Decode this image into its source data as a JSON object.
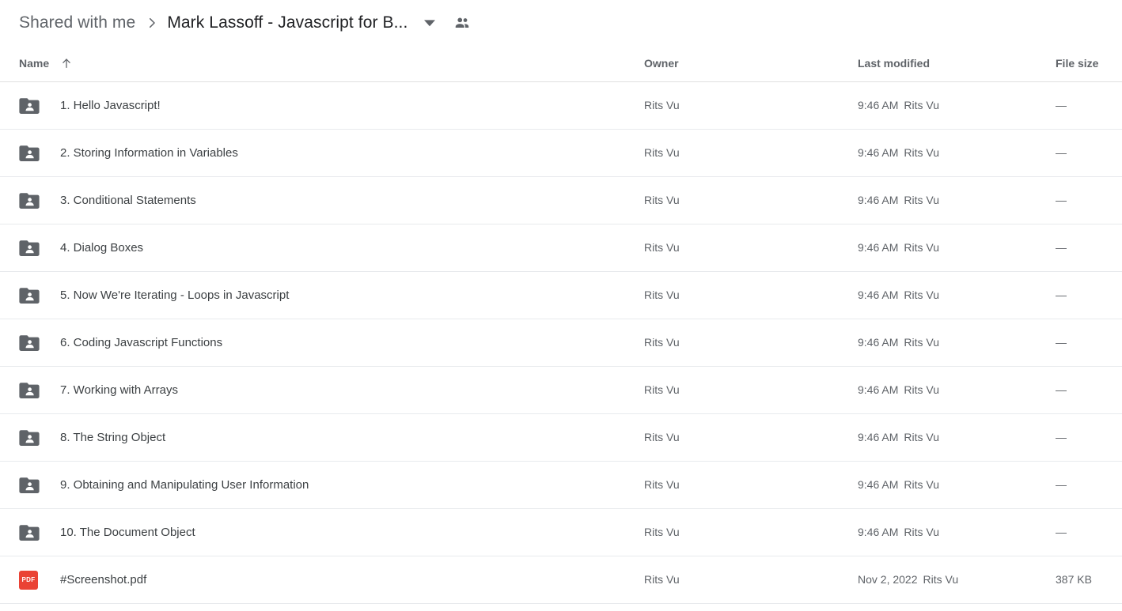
{
  "breadcrumb": {
    "root_label": "Shared with me",
    "separator_icon": "chevron-right-icon",
    "current_label": "Mark Lassoff - Javascript for B...",
    "dropdown_icon": "chevron-down-icon",
    "shared_icon": "people-shared-icon"
  },
  "columns": {
    "name": "Name",
    "sort_icon": "sort-arrow-up-icon",
    "owner": "Owner",
    "modified": "Last modified",
    "size": "File size"
  },
  "rows": [
    {
      "icon": "shared-folder-icon",
      "name": "1. Hello Javascript!",
      "shared": false,
      "owner": "Rits Vu",
      "modified_time": "9:46 AM",
      "modified_by": "Rits Vu",
      "size": "—"
    },
    {
      "icon": "shared-folder-icon",
      "name": "2. Storing Information in Variables",
      "shared": false,
      "owner": "Rits Vu",
      "modified_time": "9:46 AM",
      "modified_by": "Rits Vu",
      "size": "—"
    },
    {
      "icon": "shared-folder-icon",
      "name": "3. Conditional Statements",
      "shared": false,
      "owner": "Rits Vu",
      "modified_time": "9:46 AM",
      "modified_by": "Rits Vu",
      "size": "—"
    },
    {
      "icon": "shared-folder-icon",
      "name": "4. Dialog Boxes",
      "shared": false,
      "owner": "Rits Vu",
      "modified_time": "9:46 AM",
      "modified_by": "Rits Vu",
      "size": "—"
    },
    {
      "icon": "shared-folder-icon",
      "name": "5. Now We're Iterating - Loops in Javascript",
      "shared": false,
      "owner": "Rits Vu",
      "modified_time": "9:46 AM",
      "modified_by": "Rits Vu",
      "size": "—"
    },
    {
      "icon": "shared-folder-icon",
      "name": "6. Coding Javascript Functions",
      "shared": false,
      "owner": "Rits Vu",
      "modified_time": "9:46 AM",
      "modified_by": "Rits Vu",
      "size": "—"
    },
    {
      "icon": "shared-folder-icon",
      "name": "7. Working with Arrays",
      "shared": false,
      "owner": "Rits Vu",
      "modified_time": "9:46 AM",
      "modified_by": "Rits Vu",
      "size": "—"
    },
    {
      "icon": "shared-folder-icon",
      "name": "8. The String Object",
      "shared": false,
      "owner": "Rits Vu",
      "modified_time": "9:46 AM",
      "modified_by": "Rits Vu",
      "size": "—"
    },
    {
      "icon": "shared-folder-icon",
      "name": "9. Obtaining and Manipulating User Information",
      "shared": false,
      "owner": "Rits Vu",
      "modified_time": "9:46 AM",
      "modified_by": "Rits Vu",
      "size": "—"
    },
    {
      "icon": "shared-folder-icon",
      "name": "10. The Document Object",
      "shared": false,
      "owner": "Rits Vu",
      "modified_time": "9:46 AM",
      "modified_by": "Rits Vu",
      "size": "—"
    },
    {
      "icon": "pdf-file-icon",
      "icon_label": "PDF",
      "name": "#Screenshot.pdf",
      "shared": true,
      "shared_icon": "people-shared-icon",
      "owner": "Rits Vu",
      "modified_time": "Nov 2, 2022",
      "modified_by": "Rits Vu",
      "size": "387 KB"
    }
  ],
  "colors": {
    "folder_icon": "#5f6368",
    "pdf_icon": "#ea4335",
    "primary_text": "#3c4043",
    "secondary_text": "#5f6368",
    "divider": "#e8eaed",
    "background": "#ffffff"
  }
}
